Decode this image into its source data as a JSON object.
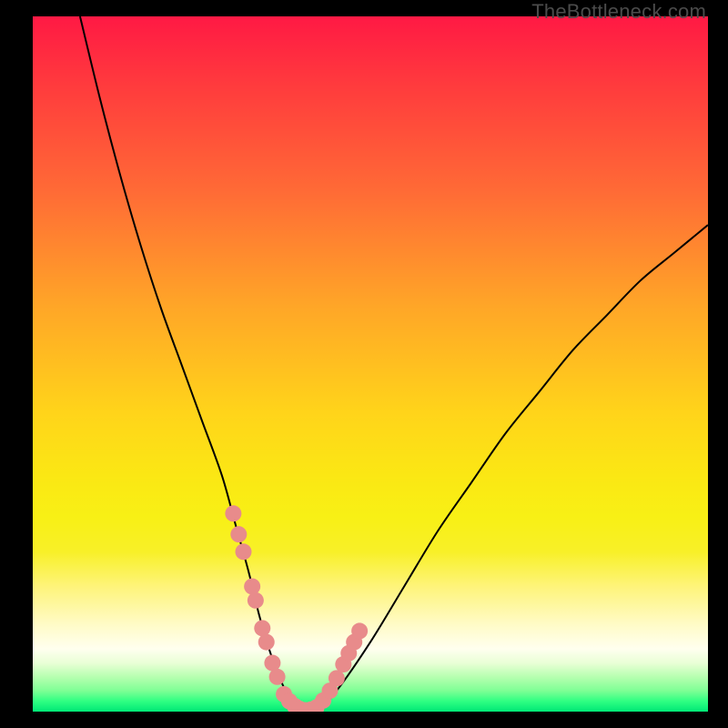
{
  "watermark": "TheBottleneck.com",
  "colors": {
    "background": "#000000",
    "curve_stroke": "#000000",
    "marker_fill": "#e88b8b",
    "gradient_top": "#ff1944",
    "gradient_bottom": "#00e876"
  },
  "chart_data": {
    "type": "line",
    "title": "",
    "xlabel": "",
    "ylabel": "",
    "xlim": [
      0,
      100
    ],
    "ylim": [
      0,
      100
    ],
    "series": [
      {
        "name": "bottleneck-curve",
        "x": [
          7,
          10,
          13,
          16,
          19,
          22,
          25,
          28,
          30,
          32,
          33.5,
          35,
          36.5,
          38,
          39.5,
          42,
          45,
          50,
          55,
          60,
          65,
          70,
          75,
          80,
          85,
          90,
          95,
          100
        ],
        "y": [
          100,
          88,
          77,
          67,
          58,
          50,
          42,
          34,
          27,
          20,
          14,
          9,
          5,
          2,
          0.5,
          0,
          3,
          10,
          18,
          26,
          33,
          40,
          46,
          52,
          57,
          62,
          66,
          70
        ]
      }
    ],
    "markers": {
      "name": "highlight-dots",
      "x": [
        29.7,
        30.5,
        31.2,
        32.5,
        33.0,
        34.0,
        34.6,
        35.5,
        36.2,
        37.2,
        38.0,
        38.8,
        39.5,
        40.3,
        41.2,
        42.0,
        43.0,
        44.0,
        45.0,
        46.0,
        46.8,
        47.6,
        48.4
      ],
      "y": [
        28.5,
        25.5,
        23.0,
        18.0,
        16.0,
        12.0,
        10.0,
        7.0,
        5.0,
        2.5,
        1.5,
        0.8,
        0.4,
        0.2,
        0.3,
        0.6,
        1.6,
        3.0,
        4.8,
        6.8,
        8.4,
        10.0,
        11.6
      ]
    }
  }
}
